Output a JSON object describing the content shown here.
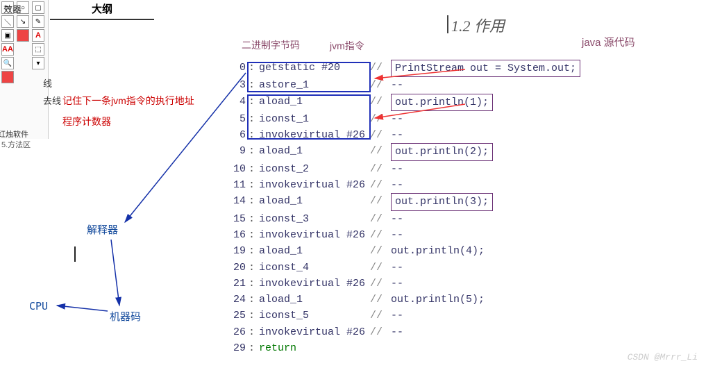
{
  "outline": {
    "title": "大纲"
  },
  "sidebar": {
    "line": "线",
    "t1": "去线",
    "t2": "效器",
    "soft": "红烛软件",
    "method": "5.方法区"
  },
  "notes": {
    "n1": "记住下一条jvm指令的执行地址",
    "n2": "程序计数器"
  },
  "flow": {
    "interp": "解释器",
    "machine": "机器码",
    "cpu": "CPU"
  },
  "title12": "1.2 作用",
  "headers": {
    "bytecode": "二进制字节码",
    "jvm": "jvm指令",
    "java": "java 源代码"
  },
  "code": [
    {
      "n": "0",
      "i": "getstatic",
      "a": "#20",
      "s": "PrintStream out = System.out;",
      "box": true
    },
    {
      "n": "3",
      "i": "astore_1",
      "a": "",
      "s": "--"
    },
    {
      "n": "4",
      "i": "aload_1",
      "a": "",
      "s": "out.println(1);",
      "box": true
    },
    {
      "n": "5",
      "i": "iconst_1",
      "a": "",
      "s": "--"
    },
    {
      "n": "6",
      "i": "invokevirtual",
      "a": "#26",
      "s": "--"
    },
    {
      "n": "9",
      "i": "aload_1",
      "a": "",
      "s": "out.println(2);",
      "box": true
    },
    {
      "n": "10",
      "i": "iconst_2",
      "a": "",
      "s": "--"
    },
    {
      "n": "11",
      "i": "invokevirtual",
      "a": "#26",
      "s": "--"
    },
    {
      "n": "14",
      "i": "aload_1",
      "a": "",
      "s": "out.println(3);",
      "box": true
    },
    {
      "n": "15",
      "i": "iconst_3",
      "a": "",
      "s": "--"
    },
    {
      "n": "16",
      "i": "invokevirtual",
      "a": "#26",
      "s": "--"
    },
    {
      "n": "19",
      "i": "aload_1",
      "a": "",
      "s": "out.println(4);"
    },
    {
      "n": "20",
      "i": "iconst_4",
      "a": "",
      "s": "--"
    },
    {
      "n": "21",
      "i": "invokevirtual",
      "a": "#26",
      "s": "--"
    },
    {
      "n": "24",
      "i": "aload_1",
      "a": "",
      "s": "out.println(5);"
    },
    {
      "n": "25",
      "i": "iconst_5",
      "a": "",
      "s": "--"
    },
    {
      "n": "26",
      "i": "invokevirtual",
      "a": "#26",
      "s": "--"
    },
    {
      "n": "29",
      "i": "return",
      "a": "",
      "s": "",
      "kw": true
    }
  ],
  "watermark": "CSDN @Mrrr_Li",
  "icons": {
    "A": "A",
    "AA": "AA",
    "mag": "🔍"
  }
}
